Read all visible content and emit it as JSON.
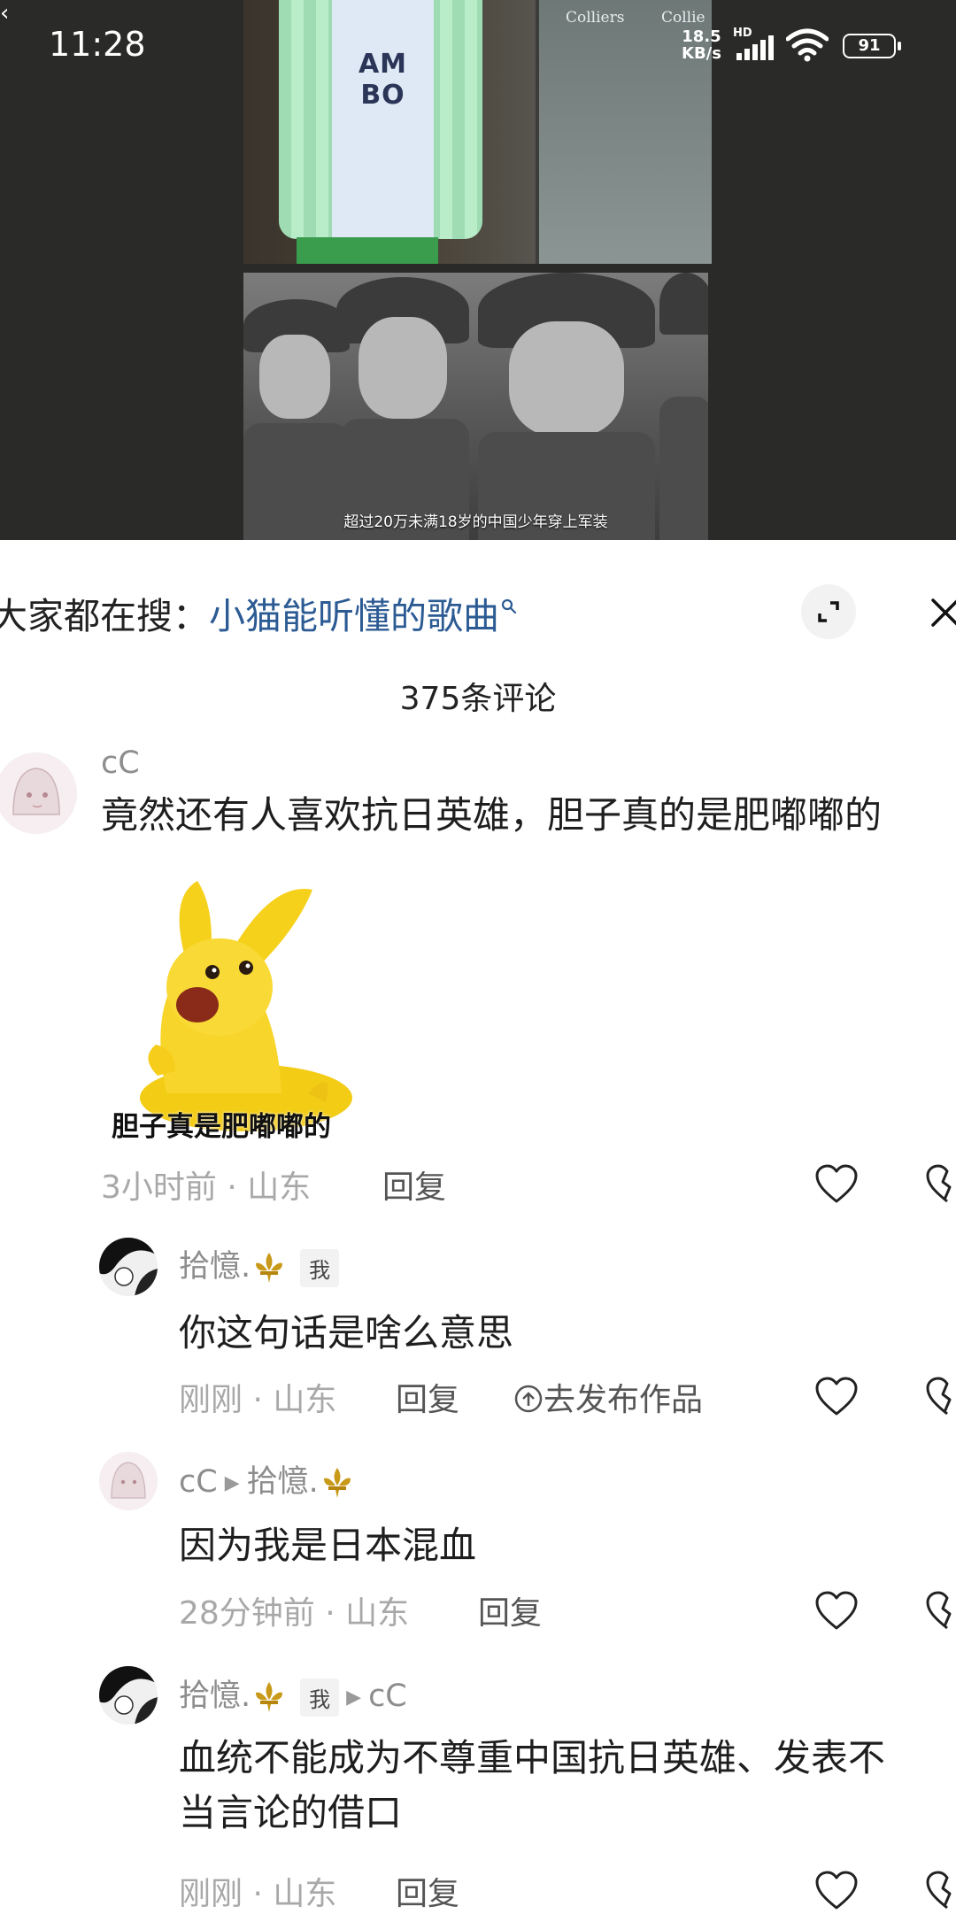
{
  "status_bar": {
    "time": "11:28",
    "net_speed_value": "18.5",
    "net_speed_unit": "KB/s",
    "hd": "HD",
    "battery": "91"
  },
  "video": {
    "store_sign_1": "Colliers",
    "store_sign_2": "Collie",
    "shirt_text": "AM BO",
    "caption": "超过20万未满18岁的中国少年穿上军装"
  },
  "panel": {
    "search_prefix": "大家都在搜：",
    "search_keyword": "小猫能听懂的歌曲",
    "comment_count": "375条评论"
  },
  "comments": [
    {
      "username": "cC",
      "text": "竟然还有人喜欢抗日英雄，胆子真的是肥嘟嘟的",
      "sticker_caption": "胆子真是肥嘟嘟的",
      "time_location": "3小时前 · 山东",
      "reply_label": "回复"
    },
    {
      "username": "拾憶.",
      "badge": "我",
      "text": "你这句话是啥么意思",
      "time_location": "刚刚 · 山东",
      "reply_label": "回复",
      "publish_label": "去发布作品"
    },
    {
      "username": "cC",
      "reply_to": "拾憶.",
      "text": "因为我是日本混血",
      "time_location": "28分钟前 · 山东",
      "reply_label": "回复"
    },
    {
      "username": "拾憶.",
      "badge": "我",
      "reply_to": "cC",
      "text_line1": "血统不能成为不尊重中国抗日英雄、发表不",
      "text_line2": "当言论的借口",
      "time_location": "刚刚 · 山东",
      "reply_label": "回复"
    }
  ],
  "icons": {
    "like": "heart-outline-icon",
    "dislike": "broken-heart-icon",
    "expand": "expand-icon",
    "close": "close-icon",
    "search": "search-icon"
  }
}
